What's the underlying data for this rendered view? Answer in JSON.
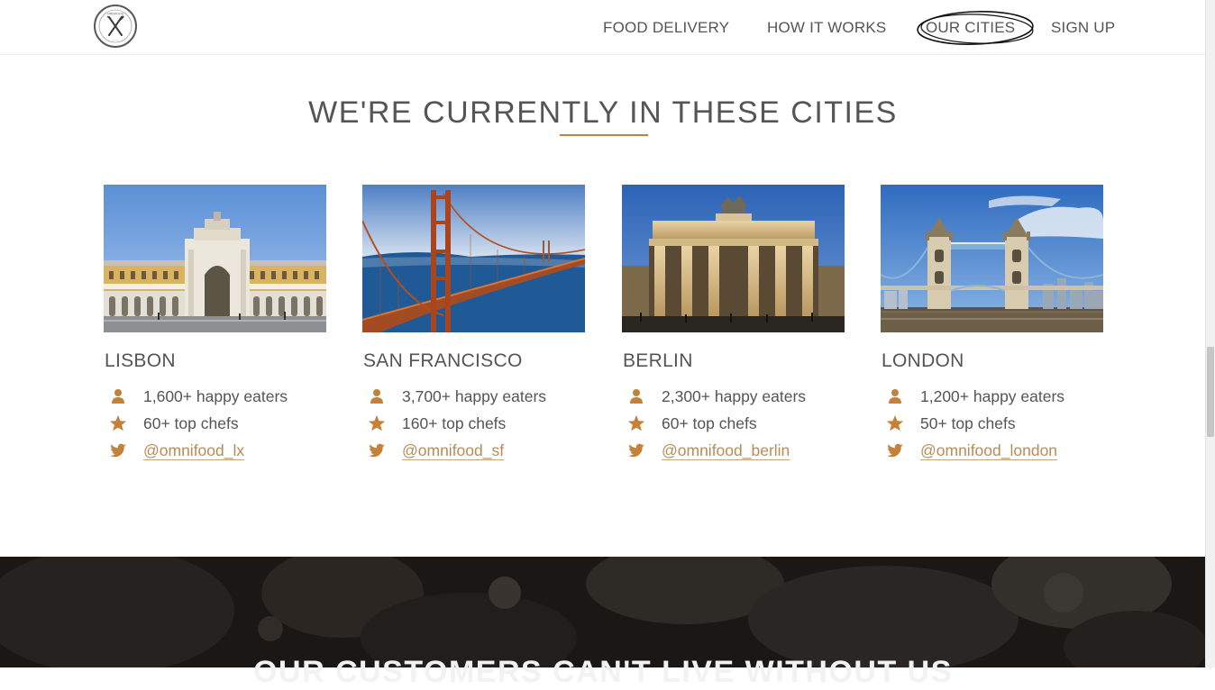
{
  "nav": {
    "logo_label": "omnifood",
    "items": [
      "FOOD DELIVERY",
      "HOW IT WORKS",
      "OUR CITIES",
      "SIGN UP"
    ]
  },
  "cities_section": {
    "title": "WE'RE CURRENTLY IN THESE CITIES",
    "cities": [
      {
        "name": "LISBON",
        "eaters": "1,600+ happy eaters",
        "chefs": "60+ top chefs",
        "twitter": "@omnifood_lx",
        "photo": "lisbon-commerce-square-arch"
      },
      {
        "name": "SAN FRANCISCO",
        "eaters": "3,700+ happy eaters",
        "chefs": "160+ top chefs",
        "twitter": "@omnifood_sf",
        "photo": "golden-gate-bridge"
      },
      {
        "name": "BERLIN",
        "eaters": "2,300+ happy eaters",
        "chefs": "60+ top chefs",
        "twitter": "@omnifood_berlin",
        "photo": "brandenburg-gate"
      },
      {
        "name": "LONDON",
        "eaters": "1,200+ happy eaters",
        "chefs": "50+ top chefs",
        "twitter": "@omnifood_london",
        "photo": "tower-bridge"
      }
    ]
  },
  "testimonials": {
    "title": "OUR CUSTOMERS CAN'T LIVE WITHOUT US"
  },
  "icons": {
    "eaters": "person-icon",
    "chefs": "star-icon",
    "twitter": "twitter-icon"
  },
  "colors": {
    "accent": "#c3813a",
    "link": "#b98b56",
    "text": "#555555",
    "band": "#1a1614"
  }
}
